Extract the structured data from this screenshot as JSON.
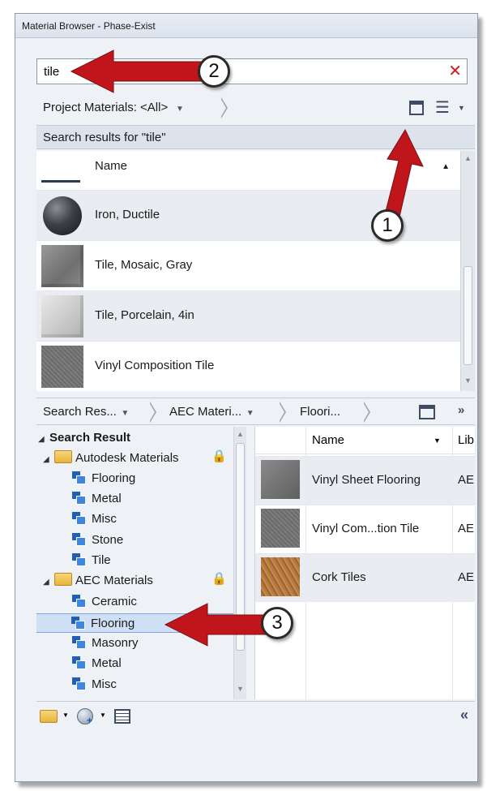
{
  "window": {
    "title": "Material Browser - Phase-Exist"
  },
  "search": {
    "value": "tile",
    "clear_icon": "close-icon"
  },
  "filter": {
    "label": "Project Materials: <All>"
  },
  "results": {
    "header": "Search results for \"tile\"",
    "column_name": "Name"
  },
  "project_materials": [
    {
      "name": "Iron, Ductile",
      "swatch": "sphere-dark-metal"
    },
    {
      "name": "Tile, Mosaic, Gray",
      "swatch": "gray-cube"
    },
    {
      "name": "Tile, Porcelain, 4in",
      "swatch": "white-cube"
    },
    {
      "name": "Vinyl Composition Tile",
      "swatch": "textured-gray-cube"
    }
  ],
  "library_breadcrumb": [
    "Search Res...",
    "AEC Materi...",
    "Floori..."
  ],
  "tree": {
    "root": "Search Result",
    "libraries": [
      {
        "name": "Autodesk Materials",
        "locked": true,
        "categories": [
          "Flooring",
          "Metal",
          "Misc",
          "Stone",
          "Tile"
        ]
      },
      {
        "name": "AEC Materials",
        "locked": true,
        "categories": [
          "Ceramic",
          "Flooring",
          "Masonry",
          "Metal",
          "Misc"
        ]
      }
    ],
    "selected": "Flooring"
  },
  "library_list": {
    "column_name": "Name",
    "column_library": "Lib",
    "rows": [
      {
        "name": "Vinyl Sheet Flooring",
        "lib": "AE"
      },
      {
        "name": "Vinyl Com...tion Tile",
        "lib": "AE"
      },
      {
        "name": "Cork Tiles",
        "lib": "AE"
      }
    ]
  },
  "callouts": [
    "1",
    "2",
    "3"
  ],
  "colors": {
    "arrow": "#c0161b",
    "selection": "#cfe0f6",
    "clear": "#d11b1b"
  }
}
